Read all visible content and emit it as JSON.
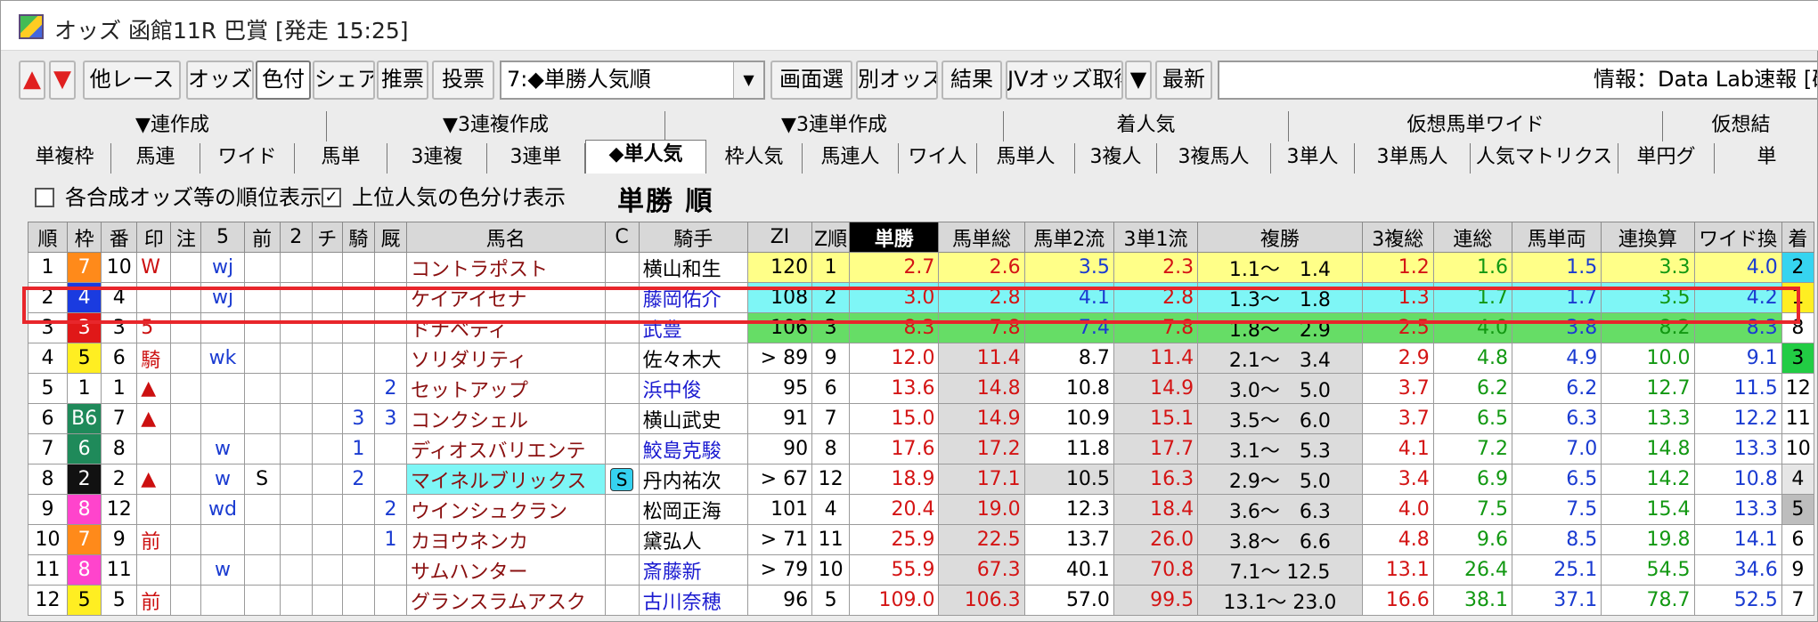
{
  "window": {
    "title": "オッズ 函館11R 巴賞 [発走 15:25]"
  },
  "toolbar": {
    "up": "▲",
    "down": "▼",
    "buttons": [
      "他レース",
      "オッズ",
      "色付",
      "シェア",
      "推票",
      "投票"
    ],
    "sort_select": "7:◆単勝人気順",
    "buttons2": [
      "画面選",
      "別オッズ",
      "結果",
      "JVオッズ取得",
      "▼",
      "最新"
    ],
    "info": "情報：Data Lab速報 [確定"
  },
  "tabs_top": [
    "▼連作成",
    "▼3連複作成",
    "▼3連単作成",
    "着人気",
    "仮想馬単ワイド",
    "仮想結"
  ],
  "tabs_bottom": [
    "単複枠",
    "馬連",
    "ワイド",
    "馬単",
    "3連複",
    "3連単",
    "◆単人気",
    "枠人気",
    "馬連人",
    "ワイ人",
    "馬単人",
    "3複人",
    "3複馬人",
    "3単人",
    "3単馬人",
    "人気マトリクス",
    "単円グ",
    "単"
  ],
  "options": {
    "opt1": "各合成オッズ等の順位表示",
    "opt1_checked": "",
    "opt2": "上位人気の色分け表示",
    "opt2_checked": "✓",
    "heading": "単勝 順"
  },
  "table": {
    "headers": [
      "順",
      "枠",
      "番",
      "印",
      "注",
      "5",
      "前",
      "2",
      "チ",
      "騎",
      "厩",
      "馬名",
      "C",
      "騎手",
      "ZI",
      "Z順",
      "単勝",
      "馬単総",
      "馬単2流",
      "3単1流",
      "複勝",
      "3複総",
      "連総",
      "馬単両",
      "連換算",
      "ワイド換",
      "着"
    ],
    "rows": [
      {
        "rank": "1",
        "waku": "7",
        "num": "10",
        "mark": "W",
        "chu": "",
        "c5": "wj",
        "mae": "",
        "n2": "",
        "chi": "",
        "ki": "",
        "kyu": "",
        "name": "コントラポスト",
        "c": "",
        "jockey": "横山和生",
        "zi": "120",
        "zr": "1",
        "tan": "2.7",
        "ut": "2.6",
        "u2": "3.5",
        "s1": "2.3",
        "fuku": "1.1～　1.4",
        "f3": "1.2",
        "ren": "1.6",
        "ur": "1.5",
        "rk": "3.3",
        "wd": "4.0",
        "chaku": "2"
      },
      {
        "rank": "2",
        "waku": "4",
        "num": "4",
        "mark": "",
        "chu": "",
        "c5": "wj",
        "mae": "",
        "n2": "",
        "chi": "",
        "ki": "",
        "kyu": "",
        "name": "ケイアイセナ",
        "c": "",
        "jockey": "藤岡佑介",
        "zi": "108",
        "zr": "2",
        "tan": "3.0",
        "ut": "2.8",
        "u2": "4.1",
        "s1": "2.8",
        "fuku": "1.3～　1.8",
        "f3": "1.3",
        "ren": "1.7",
        "ur": "1.7",
        "rk": "3.5",
        "wd": "4.2",
        "chaku": "1"
      },
      {
        "rank": "3",
        "waku": "3",
        "num": "3",
        "mark": "5",
        "chu": "",
        "c5": "",
        "mae": "",
        "n2": "",
        "chi": "",
        "ki": "",
        "kyu": "",
        "name": "ドナベティ",
        "c": "",
        "jockey": "武豊",
        "zi": "106",
        "zr": "3",
        "tan": "8.3",
        "ut": "7.8",
        "u2": "7.4",
        "s1": "7.8",
        "fuku": "1.8～　2.9",
        "f3": "2.5",
        "ren": "4.0",
        "ur": "3.8",
        "rk": "8.2",
        "wd": "8.3",
        "chaku": "8"
      },
      {
        "rank": "4",
        "waku": "5",
        "num": "6",
        "mark": "騎",
        "chu": "",
        "c5": "wk",
        "mae": "",
        "n2": "",
        "chi": "",
        "ki": "",
        "kyu": "",
        "name": "ソリダリティ",
        "c": "",
        "jockey": "佐々木大",
        "zi": "> 89",
        "zr": "9",
        "tan": "12.0",
        "ut": "11.4",
        "u2": "8.7",
        "s1": "11.4",
        "fuku": "2.1～　3.4",
        "f3": "2.9",
        "ren": "4.8",
        "ur": "4.9",
        "rk": "10.0",
        "wd": "9.1",
        "chaku": "3"
      },
      {
        "rank": "5",
        "waku": "1",
        "num": "1",
        "mark": "▲",
        "chu": "",
        "c5": "",
        "mae": "",
        "n2": "",
        "chi": "",
        "ki": "",
        "kyu": "2",
        "name": "セットアップ",
        "c": "",
        "jockey": "浜中俊",
        "zi": "95",
        "zr": "6",
        "tan": "13.6",
        "ut": "14.8",
        "u2": "10.8",
        "s1": "14.9",
        "fuku": "3.0～　5.0",
        "f3": "3.7",
        "ren": "6.2",
        "ur": "6.2",
        "rk": "12.7",
        "wd": "11.5",
        "chaku": "12"
      },
      {
        "rank": "6",
        "waku": "B6",
        "num": "7",
        "mark": "▲",
        "chu": "",
        "c5": "",
        "mae": "",
        "n2": "",
        "chi": "",
        "ki": "3",
        "kyu": "3",
        "name": "コンクシェル",
        "c": "",
        "jockey": "横山武史",
        "zi": "91",
        "zr": "7",
        "tan": "15.0",
        "ut": "14.9",
        "u2": "10.9",
        "s1": "15.1",
        "fuku": "3.5～　6.0",
        "f3": "3.7",
        "ren": "6.5",
        "ur": "6.3",
        "rk": "13.3",
        "wd": "12.2",
        "chaku": "11"
      },
      {
        "rank": "7",
        "waku": "6",
        "num": "8",
        "mark": "",
        "chu": "",
        "c5": "w",
        "mae": "",
        "n2": "",
        "chi": "",
        "ki": "1",
        "kyu": "",
        "name": "ディオスバリエンテ",
        "c": "",
        "jockey": "鮫島克駿",
        "zi": "90",
        "zr": "8",
        "tan": "17.6",
        "ut": "17.2",
        "u2": "11.8",
        "s1": "17.7",
        "fuku": "3.1～　5.3",
        "f3": "4.1",
        "ren": "7.2",
        "ur": "7.0",
        "rk": "14.8",
        "wd": "13.3",
        "chaku": "10"
      },
      {
        "rank": "8",
        "waku": "2",
        "num": "2",
        "mark": "▲",
        "chu": "",
        "c5": "w",
        "mae": "S",
        "n2": "",
        "chi": "",
        "ki": "2",
        "kyu": "",
        "name": "マイネルブリックス",
        "c": "S",
        "jockey": "丹内祐次",
        "zi": "> 67",
        "zr": "12",
        "tan": "18.9",
        "ut": "17.1",
        "u2": "10.5",
        "s1": "16.3",
        "fuku": "2.9～　5.0",
        "f3": "3.4",
        "ren": "6.9",
        "ur": "6.5",
        "rk": "14.2",
        "wd": "10.8",
        "chaku": "4"
      },
      {
        "rank": "9",
        "waku": "8",
        "num": "12",
        "mark": "",
        "chu": "",
        "c5": "wd",
        "mae": "",
        "n2": "",
        "chi": "",
        "ki": "",
        "kyu": "2",
        "name": "ウインシュクラン",
        "c": "",
        "jockey": "松岡正海",
        "zi": "101",
        "zr": "4",
        "tan": "20.4",
        "ut": "19.0",
        "u2": "12.3",
        "s1": "18.4",
        "fuku": "3.6～　6.3",
        "f3": "4.0",
        "ren": "7.5",
        "ur": "7.5",
        "rk": "15.4",
        "wd": "13.3",
        "chaku": "5"
      },
      {
        "rank": "10",
        "waku": "7",
        "num": "9",
        "mark": "前",
        "chu": "",
        "c5": "",
        "mae": "",
        "n2": "",
        "chi": "",
        "ki": "",
        "kyu": "1",
        "name": "カヨウネンカ",
        "c": "",
        "jockey": "黛弘人",
        "zi": "> 71",
        "zr": "11",
        "tan": "25.9",
        "ut": "22.5",
        "u2": "13.7",
        "s1": "26.0",
        "fuku": "3.8～　6.6",
        "f3": "4.8",
        "ren": "9.6",
        "ur": "8.5",
        "rk": "19.8",
        "wd": "14.1",
        "chaku": "6"
      },
      {
        "rank": "11",
        "waku": "8",
        "num": "11",
        "mark": "",
        "chu": "",
        "c5": "w",
        "mae": "",
        "n2": "",
        "chi": "",
        "ki": "",
        "kyu": "",
        "name": "サムハンター",
        "c": "",
        "jockey": "斎藤新",
        "zi": "> 79",
        "zr": "10",
        "tan": "55.9",
        "ut": "67.3",
        "u2": "40.1",
        "s1": "70.8",
        "fuku": "7.1～ 12.5",
        "f3": "13.1",
        "ren": "26.4",
        "ur": "25.1",
        "rk": "54.5",
        "wd": "34.6",
        "chaku": "9"
      },
      {
        "rank": "12",
        "waku": "5",
        "num": "5",
        "mark": "前",
        "chu": "",
        "c5": "",
        "mae": "",
        "n2": "",
        "chi": "",
        "ki": "",
        "kyu": "",
        "name": "グランスラムアスク",
        "c": "",
        "jockey": "古川奈穂",
        "zi": "96",
        "zr": "5",
        "tan": "109.0",
        "ut": "106.3",
        "u2": "57.0",
        "s1": "99.5",
        "fuku": "13.1～ 23.0",
        "f3": "16.6",
        "ren": "38.1",
        "ur": "37.1",
        "rk": "78.7",
        "wd": "52.5",
        "chaku": "7"
      }
    ]
  },
  "colors": {
    "accent": "#e8262b",
    "odds_red": "#d41414",
    "odds_green": "#129812",
    "odds_blue": "#1a3bd1"
  }
}
